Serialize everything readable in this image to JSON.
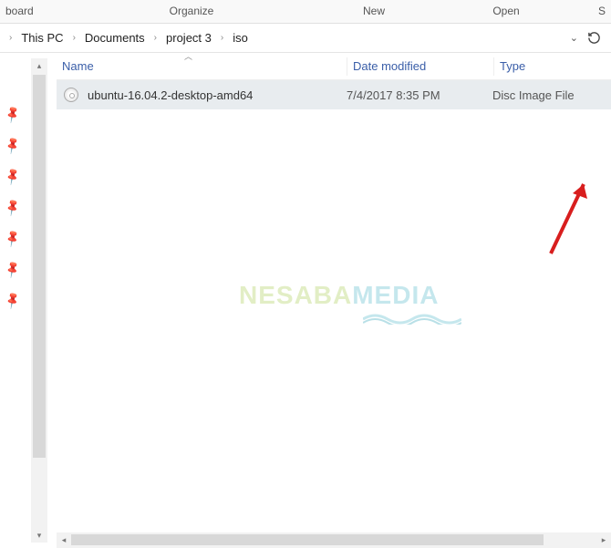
{
  "ribbon": {
    "tabs": [
      "board",
      "Organize",
      "New",
      "Open",
      "S"
    ]
  },
  "breadcrumb": {
    "items": [
      "This PC",
      "Documents",
      "project 3",
      "iso"
    ]
  },
  "columns": {
    "name": "Name",
    "date": "Date modified",
    "type": "Type"
  },
  "files": [
    {
      "name": "ubuntu-16.04.2-desktop-amd64",
      "date": "7/4/2017 8:35 PM",
      "type": "Disc Image File"
    }
  ],
  "watermark": {
    "part1": "NESABA",
    "part2": "MEDIA"
  }
}
